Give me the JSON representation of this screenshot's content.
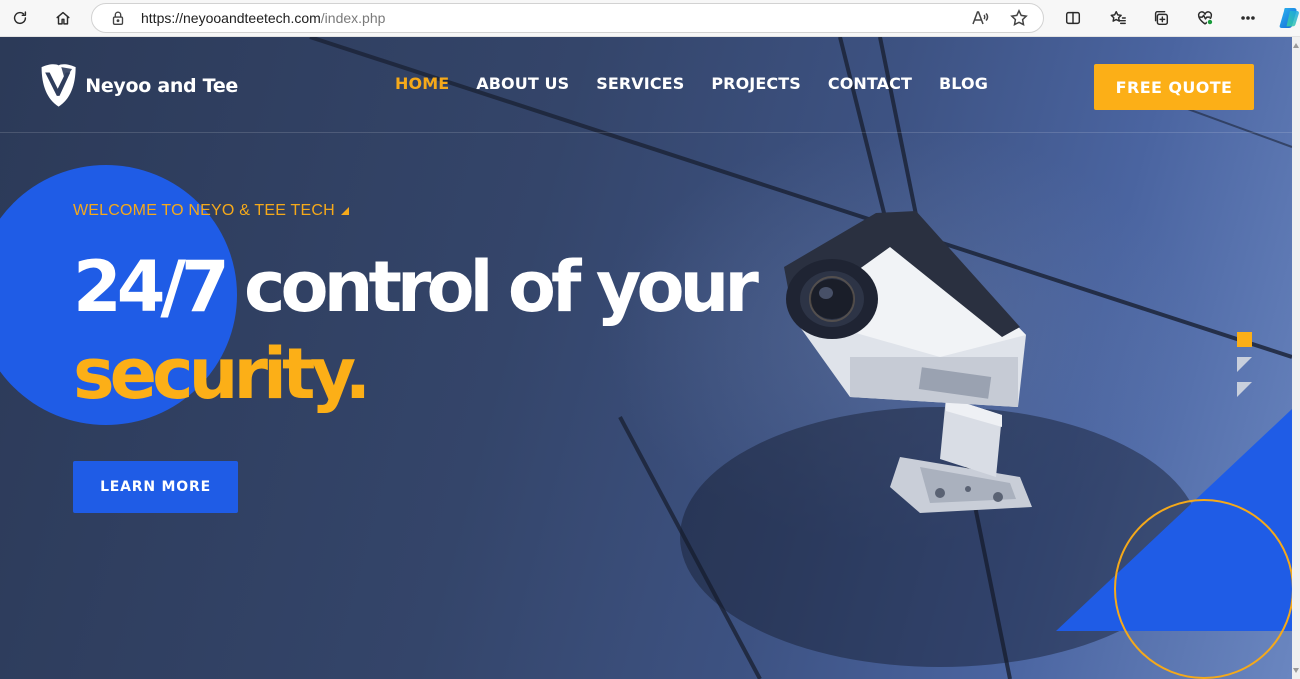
{
  "browser": {
    "url_host": "https://neyooandteetech.com",
    "url_path": "/index.php",
    "read_aloud_label": "Aʬ"
  },
  "site": {
    "brand_name": "Neyoo and Tee",
    "nav": [
      {
        "label": "HOME",
        "active": true
      },
      {
        "label": "ABOUT US",
        "active": false
      },
      {
        "label": "SERVICES",
        "active": false
      },
      {
        "label": "PROJECTS",
        "active": false
      },
      {
        "label": "CONTACT",
        "active": false
      },
      {
        "label": "BLOG",
        "active": false
      }
    ],
    "cta_label": "FREE QUOTE"
  },
  "hero": {
    "welcome": "WELCOME TO NEYO & TEE TECH",
    "headline_line1": "24/7 control of your",
    "headline_line2": "security.",
    "button_label": "LEARN MORE",
    "slides_total": 3,
    "slide_active": 1
  },
  "colors": {
    "accent_orange": "#fcaf17",
    "accent_blue": "#1f5ce6",
    "hero_dark": "#2c3a58"
  }
}
